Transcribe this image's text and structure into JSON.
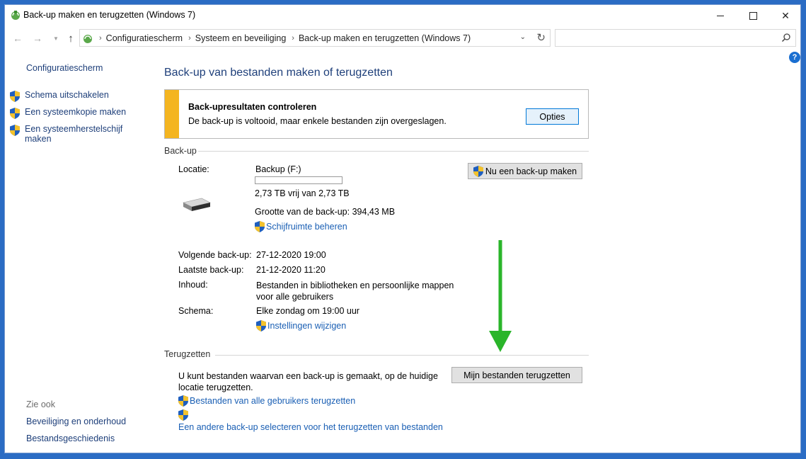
{
  "window": {
    "title": "Back-up maken en terugzetten (Windows 7)"
  },
  "address": {
    "crumbs": [
      "Configuratiescherm",
      "Systeem en beveiliging",
      "Back-up maken en terugzetten (Windows 7)"
    ],
    "search_placeholder": ""
  },
  "sidebar": {
    "home": "Configuratiescherm",
    "tasks": [
      {
        "label": "Schema uitschakelen",
        "icon": "shield-icon"
      },
      {
        "label": "Een systeemkopie maken",
        "icon": "shield-icon"
      },
      {
        "label": "Een systeemherstelschijf maken",
        "icon": "shield-icon"
      }
    ],
    "see_also_title": "Zie ook",
    "see_also": [
      "Beveiliging en onderhoud",
      "Bestandsgeschiedenis"
    ]
  },
  "main": {
    "title": "Back-up van bestanden maken of terugzetten",
    "notice": {
      "title": "Back-upresultaten controleren",
      "text": "De back-up is voltooid, maar enkele bestanden zijn overgeslagen.",
      "button": "Opties",
      "accent_color": "#f4b520"
    },
    "backup": {
      "section_label": "Back-up",
      "location_label": "Locatie:",
      "location_value": "Backup (F:)",
      "used_fraction": 0,
      "free_text": "2,73 TB vrij van 2,73 TB",
      "size_text": "Grootte van de back-up: 394,43 MB",
      "manage_link": "Schijfruimte beheren",
      "backup_now_button": "Nu een back-up maken",
      "next_label": "Volgende back-up:",
      "next_value": "27-12-2020 19:00",
      "last_label": "Laatste back-up:",
      "last_value": "21-12-2020 11:20",
      "content_label": "Inhoud:",
      "content_value": "Bestanden in bibliotheken en persoonlijke mappen voor alle gebruikers",
      "schedule_label": "Schema:",
      "schedule_value": "Elke zondag om 19:00 uur",
      "settings_link": "Instellingen wijzigen"
    },
    "restore": {
      "section_label": "Terugzetten",
      "text": "U kunt bestanden waarvan een back-up is gemaakt, op de huidige locatie terugzetten.",
      "restore_button": "Mijn bestanden terugzetten",
      "all_users_link": "Bestanden van alle gebruikers terugzetten",
      "other_backup_link": "Een andere back-up selecteren voor het terugzetten van bestanden"
    }
  },
  "annotation": {
    "arrow_color": "#2ab52a"
  }
}
